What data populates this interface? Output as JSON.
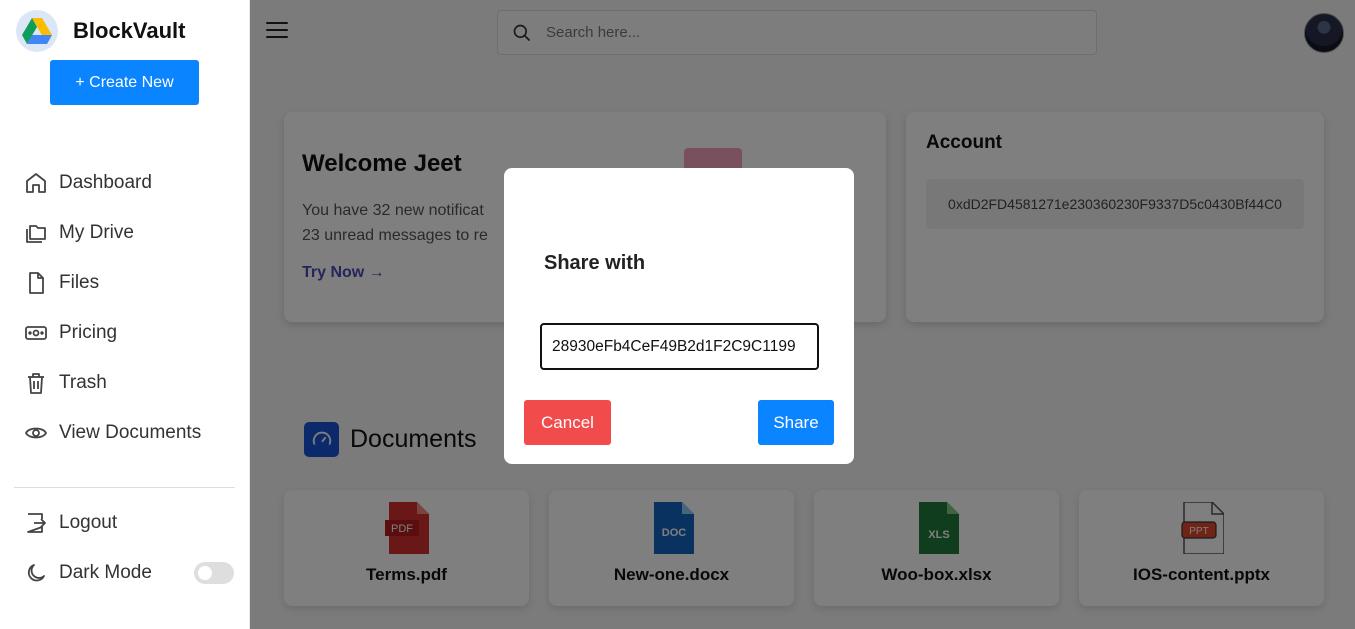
{
  "app": {
    "name": "BlockVault"
  },
  "sidebar": {
    "create_label": "+ Create New",
    "items": [
      {
        "label": "Dashboard",
        "icon": "home-icon"
      },
      {
        "label": "My Drive",
        "icon": "folder-icon"
      },
      {
        "label": "Files",
        "icon": "file-icon"
      },
      {
        "label": "Pricing",
        "icon": "money-icon"
      },
      {
        "label": "Trash",
        "icon": "trash-icon"
      },
      {
        "label": "View Documents",
        "icon": "eye-icon"
      }
    ],
    "logout_label": "Logout",
    "darkmode_label": "Dark Mode",
    "darkmode_on": false
  },
  "header": {
    "search_placeholder": "Search here..."
  },
  "welcome": {
    "title": "Welcome Jeet",
    "line1": "You have 32 new notificat",
    "line2": "23 unread messages to re",
    "cta": "Try Now →"
  },
  "account": {
    "title": "Account",
    "address": "0xdD2FD4581271e230360230F9337D5c0430Bf44C0"
  },
  "documents": {
    "title": "Documents",
    "files": [
      {
        "name": "Terms.pdf",
        "type": "PDF",
        "color": "#d32f2f"
      },
      {
        "name": "New-one.docx",
        "type": "DOC",
        "color": "#1565c0"
      },
      {
        "name": "Woo-box.xlsx",
        "type": "XLS",
        "color": "#1e7a3c"
      },
      {
        "name": "IOS-content.pptx",
        "type": "PPT",
        "color": "#e0492b"
      }
    ]
  },
  "modal": {
    "title": "Share with",
    "input_value": "28930eFb4CeF49B2d1F2C9C1199",
    "cancel_label": "Cancel",
    "share_label": "Share"
  },
  "colors": {
    "primary": "#0a84ff",
    "danger": "#f24b4b",
    "overlay": "rgba(0,0,0,0.5)"
  }
}
